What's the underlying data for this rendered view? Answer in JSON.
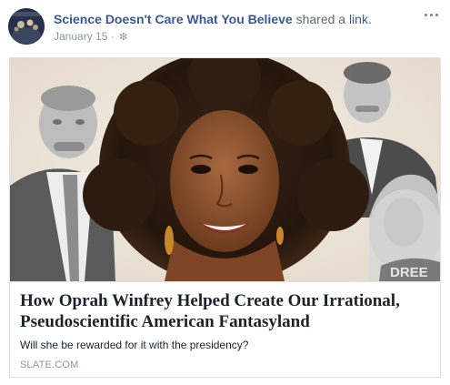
{
  "post": {
    "page_name": "Science Doesn't Care What You Believe",
    "action_text": "shared a",
    "link_word": "link.",
    "date": "January 15",
    "separator": "·",
    "privacy_icon": "gear-icon",
    "more_icon": "ellipsis-icon"
  },
  "link_card": {
    "title": "How Oprah Winfrey Helped Create Our Irrational, Pseudoscientific American Fantasyland",
    "description": "Will she be rewarded for it with the presidency?",
    "domain": "SLATE.COM",
    "shirt_text": "DREE"
  },
  "colors": {
    "link_blue": "#365899",
    "meta_gray": "#90949c",
    "border": "#dddfe2",
    "text": "#1d2129"
  }
}
